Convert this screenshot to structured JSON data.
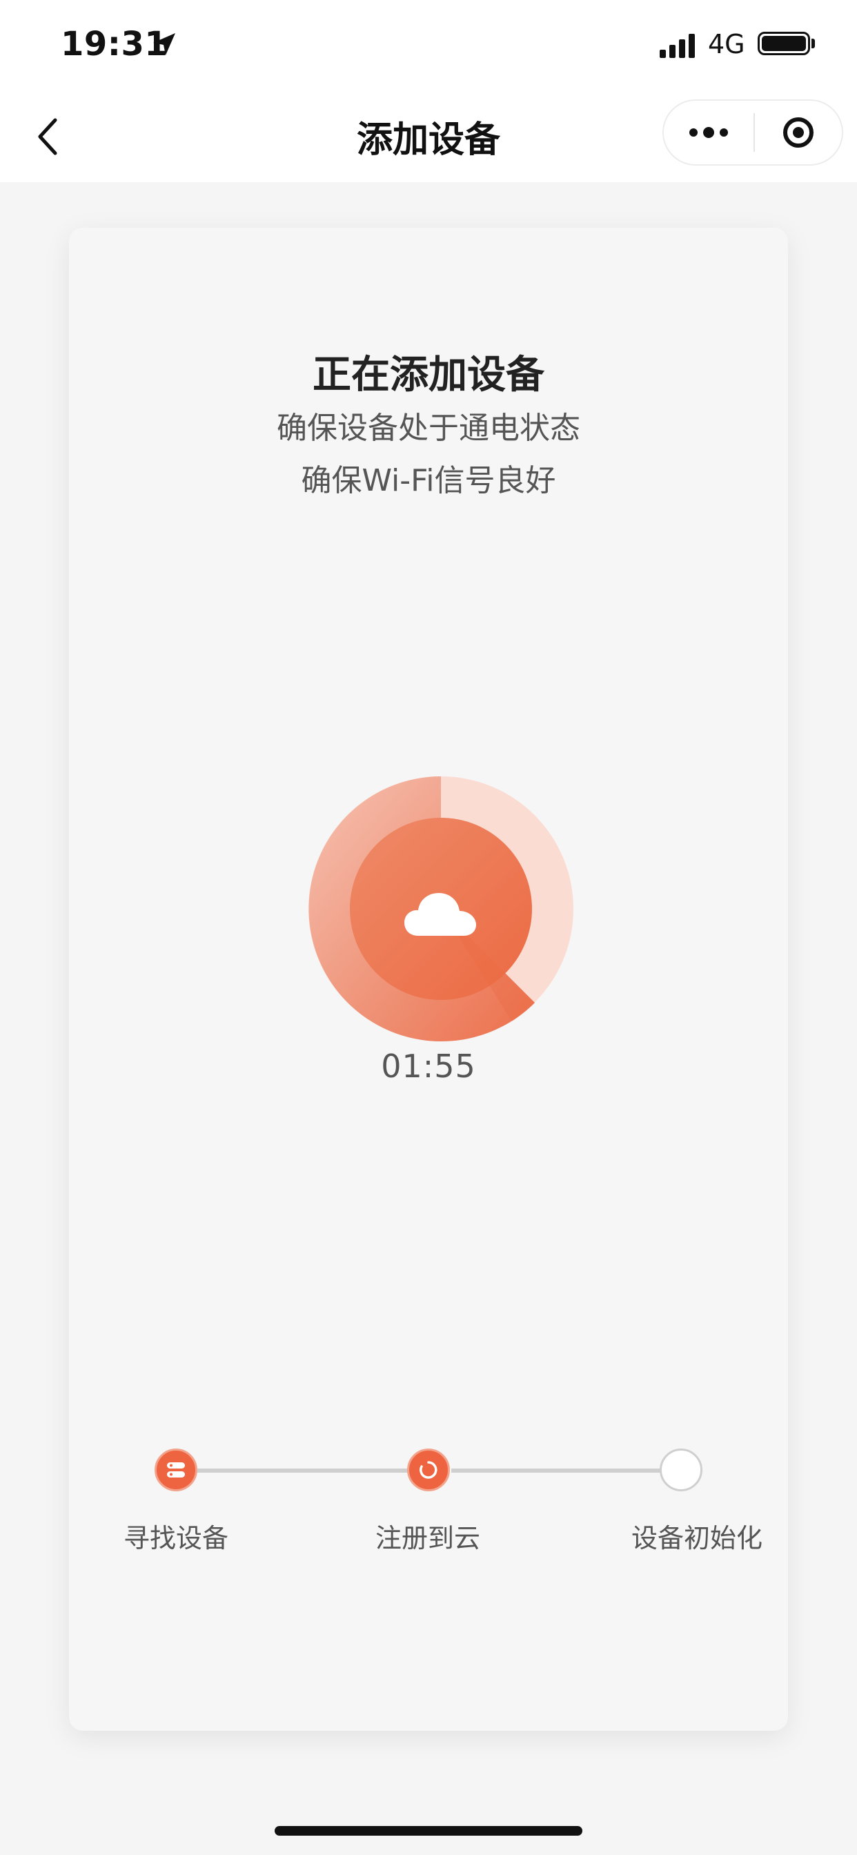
{
  "status_bar": {
    "time": "19:31",
    "location_icon": "location-arrow-icon",
    "signal_icon": "cellular-signal-icon",
    "network": "4G",
    "battery_icon": "battery-icon"
  },
  "nav": {
    "back_icon": "chevron-left-icon",
    "title": "添加设备",
    "more_icon": "more-dots-icon",
    "close_icon": "target-close-icon"
  },
  "card": {
    "title": "正在添加设备",
    "tips": [
      "确保设备处于通电状态",
      "确保Wi-Fi信号良好"
    ],
    "center_icon": "cloud-icon",
    "countdown": "01:55",
    "accent_color": "#ef6440"
  },
  "steps": [
    {
      "label": "寻找设备",
      "status": "done",
      "icon": "server-icon"
    },
    {
      "label": "注册到云",
      "status": "in-progress",
      "icon": "spinner-icon"
    },
    {
      "label": "设备初始化",
      "status": "pending",
      "icon": ""
    }
  ]
}
